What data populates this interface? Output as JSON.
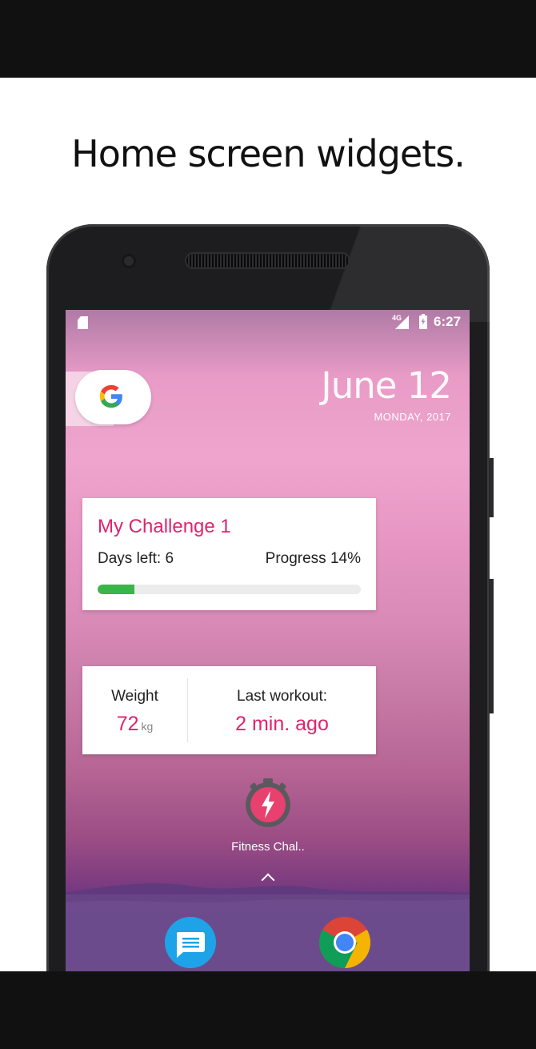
{
  "headline": "Home screen widgets.",
  "status_bar": {
    "network": "4G",
    "time": "6:27",
    "icons": [
      "sd-card-icon",
      "signal-icon",
      "battery-charging-icon"
    ]
  },
  "home": {
    "date": "June 12",
    "weekday_year": "MONDAY, 2017",
    "google_search_icon": "google-g-icon"
  },
  "challenge_widget": {
    "title": "My Challenge 1",
    "days_left": "Days left: 6",
    "progress_label": "Progress 14%",
    "progress_value": 0.14,
    "progress_color": "#3ab54a"
  },
  "stats_widget": {
    "weight_label": "Weight",
    "weight_value": "72",
    "weight_unit": "kg",
    "workout_label": "Last workout:",
    "workout_value": "2 min. ago"
  },
  "app_shortcut": {
    "label": "Fitness Chal..",
    "icon": "stopwatch-bolt-icon"
  },
  "dock": {
    "apps": [
      "messages-icon",
      "chrome-icon"
    ]
  },
  "colors": {
    "accent": "#e0236d",
    "progress": "#3ab54a"
  }
}
